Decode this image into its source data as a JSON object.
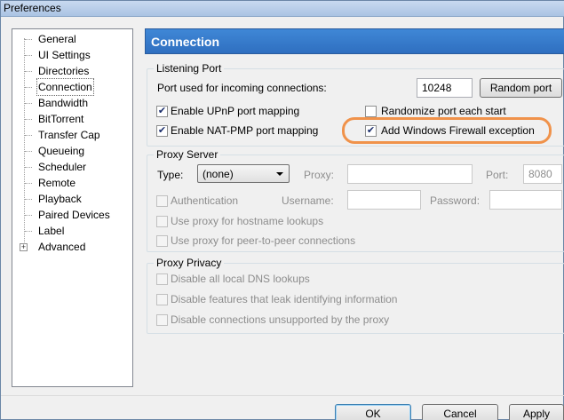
{
  "window": {
    "title": "Preferences"
  },
  "tree": {
    "items": [
      {
        "label": "General"
      },
      {
        "label": "UI Settings"
      },
      {
        "label": "Directories"
      },
      {
        "label": "Connection",
        "selected": true
      },
      {
        "label": "Bandwidth"
      },
      {
        "label": "BitTorrent"
      },
      {
        "label": "Transfer Cap"
      },
      {
        "label": "Queueing"
      },
      {
        "label": "Scheduler"
      },
      {
        "label": "Remote"
      },
      {
        "label": "Playback"
      },
      {
        "label": "Paired Devices"
      },
      {
        "label": "Label"
      },
      {
        "label": "Advanced",
        "expander": "+"
      }
    ]
  },
  "header": {
    "title": "Connection"
  },
  "listening_port": {
    "group_label": "Listening Port",
    "port_label": "Port used for incoming connections:",
    "port_value": "10248",
    "random_button": "Random port",
    "upnp": {
      "label": "Enable UPnP port mapping",
      "checked": true
    },
    "natpmp": {
      "label": "Enable NAT-PMP port mapping",
      "checked": true
    },
    "randomize": {
      "label": "Randomize port each start",
      "checked": false
    },
    "firewall": {
      "label": "Add Windows Firewall exception",
      "checked": true
    }
  },
  "proxy_server": {
    "group_label": "Proxy Server",
    "type_label": "Type:",
    "type_value": "(none)",
    "proxy_label": "Proxy:",
    "proxy_value": "",
    "port_label": "Port:",
    "port_value": "8080",
    "auth": {
      "label": "Authentication",
      "checked": false
    },
    "username_label": "Username:",
    "password_label": "Password:",
    "hostname": {
      "label": "Use proxy for hostname lookups",
      "checked": false
    },
    "p2p": {
      "label": "Use proxy for peer-to-peer connections",
      "checked": false
    }
  },
  "proxy_privacy": {
    "group_label": "Proxy Privacy",
    "dns": {
      "label": "Disable all local DNS lookups",
      "checked": false
    },
    "leak": {
      "label": "Disable features that leak identifying information",
      "checked": false
    },
    "unsupported": {
      "label": "Disable connections unsupported by the proxy",
      "checked": false
    }
  },
  "footer": {
    "ok": "OK",
    "cancel": "Cancel",
    "apply": "Apply"
  },
  "colors": {
    "header_bg": "#3278c8",
    "highlight_ring": "#f0924a",
    "selected_bg": "#ffffff"
  }
}
